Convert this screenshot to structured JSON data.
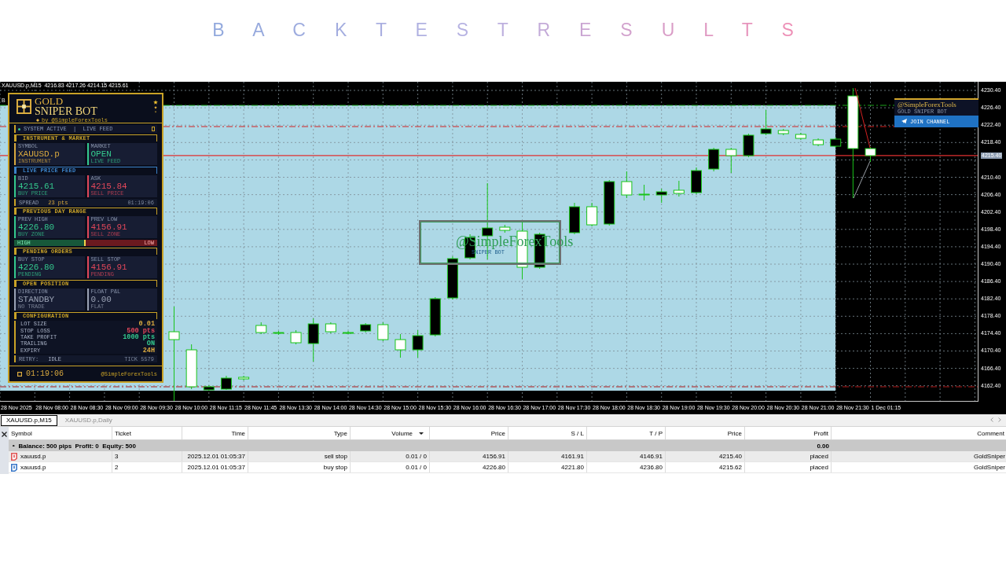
{
  "page_title": "B A C K T E S T R E S U L T S",
  "chart": {
    "header": "XAUUSD.p,M15  4216.83 4217.26 4214.15 4215.61",
    "edge_label": "B",
    "label_object": {
      "title": "@SimpleForexTools",
      "subtitle": "SNIPER BOT"
    },
    "promo": {
      "title": "@SimpleForexTools",
      "subtitle": "GOLD SNIPER BOT",
      "button": "JOIN CHANNEL"
    },
    "bot_panel": {
      "title": "GOLD",
      "subtitle": "SNIPER BOT",
      "byline": "by @SimpleForexTools",
      "status": "SYSTEM ACTIVE  |  LIVE FEED",
      "sections": [
        {
          "title": "INSTRUMENT & MARKET",
          "color": "#c9a227",
          "kind": "cards",
          "cards": [
            {
              "label": "SYMBOL",
              "value": "XAUUSD.p",
              "note": "INSTRUMENT",
              "color": "#d9a93f"
            },
            {
              "label": "MARKET",
              "value": "OPEN",
              "note": "LIVE FEED",
              "color": "#34c98e"
            }
          ]
        },
        {
          "title": "LIVE PRICE FEED",
          "color": "#3b82c8",
          "kind": "cards",
          "cards": [
            {
              "label": "BID",
              "value": "4215.61",
              "note": "BUY PRICE",
              "color": "#34c98e"
            },
            {
              "label": "ASK",
              "value": "4215.84",
              "note": "SELL PRICE",
              "color": "#e0475a"
            }
          ],
          "info_row": {
            "label": "SPREAD",
            "value": "23 pts",
            "right": "01:19:06"
          }
        },
        {
          "title": "PREVIOUS DAY RANGE",
          "color": "#c9a227",
          "kind": "cards",
          "cards": [
            {
              "label": "PREV HIGH",
              "value": "4226.80",
              "note": "BUY ZONE",
              "color": "#34c98e"
            },
            {
              "label": "PREV LOW",
              "value": "4156.91",
              "note": "SELL ZONE",
              "color": "#e0475a"
            }
          ],
          "range_bar": {
            "left_label": "HIGH",
            "right_label": "LOW",
            "level": 0.5
          }
        },
        {
          "title": "PENDING ORDERS",
          "color": "#c9a227",
          "kind": "cards",
          "cards": [
            {
              "label": "BUY STOP",
              "value": "4226.80",
              "note": "PENDING",
              "color": "#34c98e"
            },
            {
              "label": "SELL STOP",
              "value": "4156.91",
              "note": "PENDING",
              "color": "#e0475a"
            }
          ]
        },
        {
          "title": "OPEN POSITION",
          "color": "#c9a227",
          "kind": "cards",
          "cards": [
            {
              "label": "DIRECTION",
              "value": "STANDBY",
              "note": "NO TRADE",
              "color": "#9aa2b4"
            },
            {
              "label": "FLOAT P&L",
              "value": "0.00",
              "note": "FLAT",
              "color": "#9aa2b4"
            }
          ]
        },
        {
          "title": "CONFIGURATION",
          "color": "#c9a227",
          "kind": "settings",
          "settings": [
            {
              "label": "LOT SIZE",
              "value": "0.01",
              "color": "#d9a93f"
            },
            {
              "label": "STOP LOSS",
              "value": "500 pts",
              "color": "#e0475a"
            },
            {
              "label": "TAKE PROFIT",
              "value": "1000 pts",
              "color": "#34c98e"
            },
            {
              "label": "TRAILING",
              "value": "ON",
              "color": "#34c98e"
            },
            {
              "label": "EXPIRY",
              "value": "24H",
              "color": "#d9a93f"
            }
          ],
          "info_row": {
            "label": "RETRY:",
            "value": "IDLE",
            "right": "TICK 5579"
          }
        }
      ],
      "clock": "01:19:06",
      "signature": "@SimpleForexTools"
    },
    "price_axis": [
      {
        "label": "4230.40",
        "kind": "tick"
      },
      {
        "label": "4226.40",
        "kind": "tick"
      },
      {
        "label": "4222.40",
        "kind": "tick"
      },
      {
        "label": "4218.40",
        "kind": "tick"
      },
      {
        "label": "4215.40",
        "kind": "current"
      },
      {
        "label": "4210.40",
        "kind": "tick"
      },
      {
        "label": "4206.40",
        "kind": "tick"
      },
      {
        "label": "4202.40",
        "kind": "tick"
      },
      {
        "label": "4198.40",
        "kind": "tick"
      },
      {
        "label": "4194.40",
        "kind": "tick"
      },
      {
        "label": "4190.40",
        "kind": "tick"
      },
      {
        "label": "4186.40",
        "kind": "tick"
      },
      {
        "label": "4182.40",
        "kind": "tick"
      },
      {
        "label": "4178.40",
        "kind": "tick"
      },
      {
        "label": "4174.40",
        "kind": "tick"
      },
      {
        "label": "4170.40",
        "kind": "tick"
      },
      {
        "label": "4166.40",
        "kind": "tick"
      },
      {
        "label": "4162.40",
        "kind": "tick"
      }
    ],
    "time_axis": [
      "28 Nov 2025",
      "28 Nov 08:00",
      "28 Nov 08:30",
      "28 Nov 09:00",
      "28 Nov 09:30",
      "28 Nov 10:00",
      "28 Nov 11:15",
      "28 Nov 11:45",
      "28 Nov 13:30",
      "28 Nov 14:00",
      "28 Nov 14:30",
      "28 Nov 15:00",
      "28 Nov 15:30",
      "28 Nov 16:00",
      "28 Nov 16:30",
      "28 Nov 17:00",
      "28 Nov 17:30",
      "28 Nov 18:00",
      "28 Nov 18:30",
      "28 Nov 19:00",
      "28 Nov 19:30",
      "28 Nov 20:00",
      "28 Nov 20:30",
      "28 Nov 21:00",
      "28 Nov 21:30",
      "1 Dec 01:15"
    ]
  },
  "tabs": [
    {
      "label": "XAUUSD.p,M15",
      "selected": true
    },
    {
      "label": "XAUUSD.p,Daily",
      "selected": false
    }
  ],
  "table": {
    "columns": [
      {
        "label": "Symbol",
        "sorted": false
      },
      {
        "label": "Ticket",
        "sorted": false
      },
      {
        "label": "Time",
        "sorted": false
      },
      {
        "label": "Type",
        "sorted": false
      },
      {
        "label": "Volume",
        "sorted": true
      },
      {
        "label": "Price",
        "sorted": false
      },
      {
        "label": "S / L",
        "sorted": false
      },
      {
        "label": "T / P",
        "sorted": false
      },
      {
        "label": "Price",
        "sorted": false
      },
      {
        "label": "Profit",
        "sorted": false
      },
      {
        "label": "Comment",
        "sorted": false
      }
    ],
    "balance": {
      "summary": "Balance: 500 pips  Profit: 0  Equity: 500",
      "profit": "0.00"
    },
    "rows": [
      {
        "selected": true,
        "color": "#e05555",
        "cells": [
          "xauusd.p",
          "3",
          "2025.12.01 01:05:37",
          "sell stop",
          "0.01 / 0",
          "4156.91",
          "4161.91",
          "4146.91",
          "4215.40",
          "placed",
          "GoldSniper"
        ]
      },
      {
        "selected": false,
        "color": "#3a78c8",
        "cells": [
          "xauusd.p",
          "2",
          "2025.12.01 01:05:37",
          "buy stop",
          "0.01 / 0",
          "4226.80",
          "4221.80",
          "4236.80",
          "4215.62",
          "placed",
          "GoldSniper"
        ]
      }
    ]
  }
}
